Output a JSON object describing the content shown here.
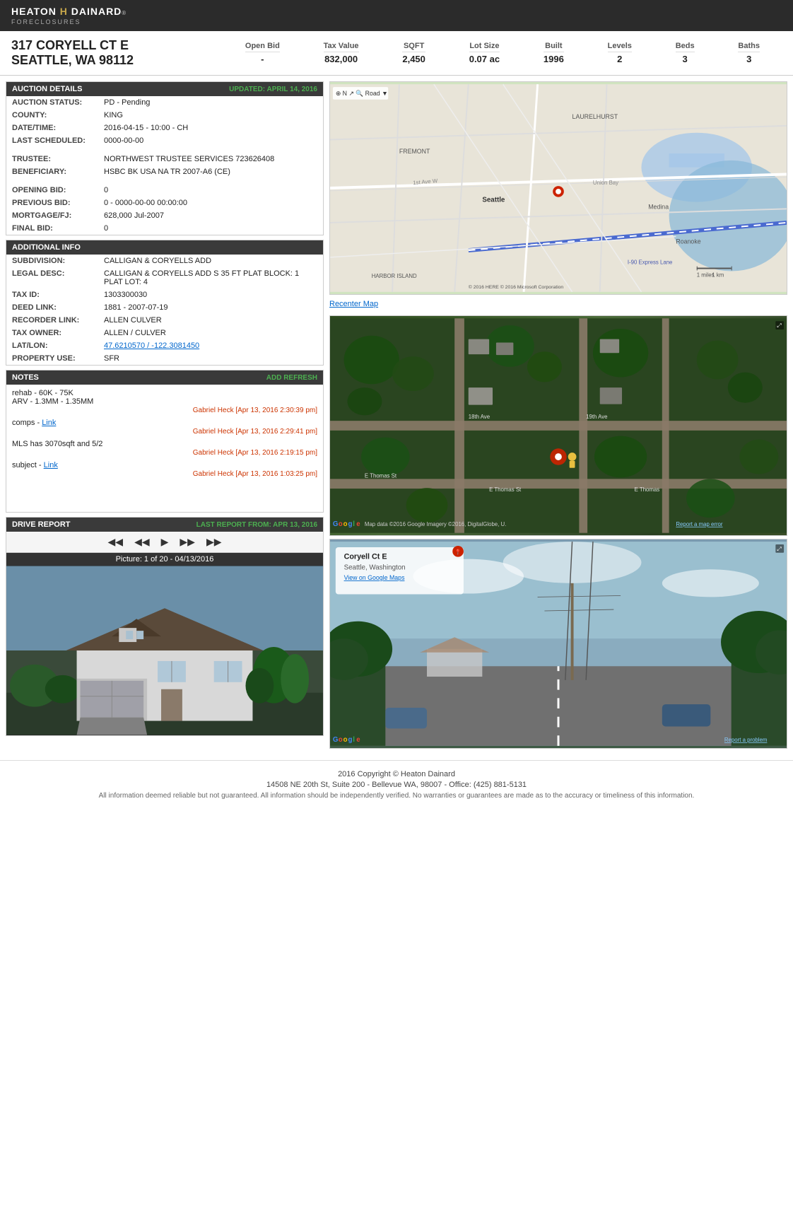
{
  "header": {
    "logo_part1": "HEATON",
    "logo_separator": "H",
    "logo_part2": "DAINARD",
    "logo_sub": "FORECLOSURES"
  },
  "property": {
    "address_line1": "317 CORYELL CT E",
    "address_line2": "SEATTLE, WA 98112",
    "stats": [
      {
        "label": "Open Bid",
        "value": "-"
      },
      {
        "label": "Tax Value",
        "value": "832,000"
      },
      {
        "label": "SQFT",
        "value": "2,450"
      },
      {
        "label": "Lot Size",
        "value": "0.07 ac"
      },
      {
        "label": "Built",
        "value": "1996"
      },
      {
        "label": "Levels",
        "value": "2"
      },
      {
        "label": "Beds",
        "value": "3"
      },
      {
        "label": "Baths",
        "value": "3"
      }
    ]
  },
  "auction_details": {
    "section_title": "AUCTION DETAILS",
    "updated_label": "UPDATED: APRIL 14, 2016",
    "fields": [
      {
        "label": "AUCTION STATUS:",
        "value": "PD - Pending"
      },
      {
        "label": "COUNTY:",
        "value": "KING"
      },
      {
        "label": "DATE/TIME:",
        "value": "2016-04-15 - 10:00 - CH"
      },
      {
        "label": "LAST SCHEDULED:",
        "value": "0000-00-00"
      },
      {
        "label": "TRUSTEE:",
        "value": "NORTHWEST TRUSTEE SERVICES 723626408"
      },
      {
        "label": "BENEFICIARY:",
        "value": "HSBC BK USA NA TR 2007-A6 (CE)"
      },
      {
        "label": "OPENING BID:",
        "value": "0"
      },
      {
        "label": "PREVIOUS BID:",
        "value": "0 - 0000-00-00 00:00:00"
      },
      {
        "label": "MORTGAGE/FJ:",
        "value": "628,000 Jul-2007"
      },
      {
        "label": "FINAL BID:",
        "value": "0"
      }
    ]
  },
  "additional_info": {
    "section_title": "ADDITIONAL INFO",
    "fields": [
      {
        "label": "SUBDIVISION:",
        "value": "CALLIGAN & CORYELLS ADD"
      },
      {
        "label": "LEGAL DESC:",
        "value": "CALLIGAN & CORYELLS ADD S 35 FT PLAT BLOCK: 1 PLAT LOT: 4"
      },
      {
        "label": "TAX ID:",
        "value": "1303300030"
      },
      {
        "label": "DEED LINK:",
        "value": "1881 - 2007-07-19"
      },
      {
        "label": "RECORDER LINK:",
        "value": "ALLEN CULVER"
      },
      {
        "label": "TAX OWNER:",
        "value": "ALLEN / CULVER"
      },
      {
        "label": "LAT/LON:",
        "value": "47.6210570 / -122.3081450",
        "is_link": true
      },
      {
        "label": "PROPERTY USE:",
        "value": "SFR"
      }
    ]
  },
  "notes": {
    "section_title": "NOTES",
    "add_refresh_label": "ADD REFRESH",
    "entries": [
      {
        "text": "rehab - 60K - 75K\nARV - 1.3MM - 1.35MM",
        "author": "Gabriel Heck",
        "date": "[Apr 13, 2016 2:30:39 pm]"
      },
      {
        "text": "comps - ",
        "link_text": "Link",
        "author": "Gabriel Heck",
        "date": "[Apr 13, 2016 2:29:41 pm]"
      },
      {
        "text": "MLS has 3070sqft and 5/2",
        "author": "Gabriel Heck",
        "date": "[Apr 13, 2016 2:19:15 pm]"
      },
      {
        "text": "subject - ",
        "link_text": "Link",
        "author": "Gabriel Heck",
        "date": "[Apr 13, 2016 1:03:25 pm]"
      }
    ]
  },
  "drive_report": {
    "section_title": "DRIVE REPORT",
    "last_report_label": "LAST REPORT FROM: APR 13, 2016",
    "photo_label": "Picture: 1 of 20 - 04/13/2016"
  },
  "map": {
    "recenter_label": "Recenter Map",
    "road_label": "Road ▼",
    "scale_1mi": "1 miles",
    "scale_1km": "1 km",
    "bing_attribution": "© 2016 HERE  © 2016 Microsoft Corporation"
  },
  "street_view": {
    "title": "Coryell Ct E",
    "subtitle": "Seattle, Washington",
    "link_text": "View on Google Maps",
    "google_attribution": "Map data ©2016 Google Imagery ©2016, DigitalGlobe, U.",
    "report_problem": "Report a map error",
    "report_problem2": "Report a problem"
  },
  "footer": {
    "copyright": "2016 Copyright © Heaton Dainard",
    "address": "14508 NE 20th St, Suite 200 - Bellevue WA, 98007 - Office: (425) 881-5131",
    "disclaimer": "All information deemed reliable but not guaranteed. All information should be independently verified. No warranties or guarantees are made as to the accuracy or timeliness of this information."
  }
}
